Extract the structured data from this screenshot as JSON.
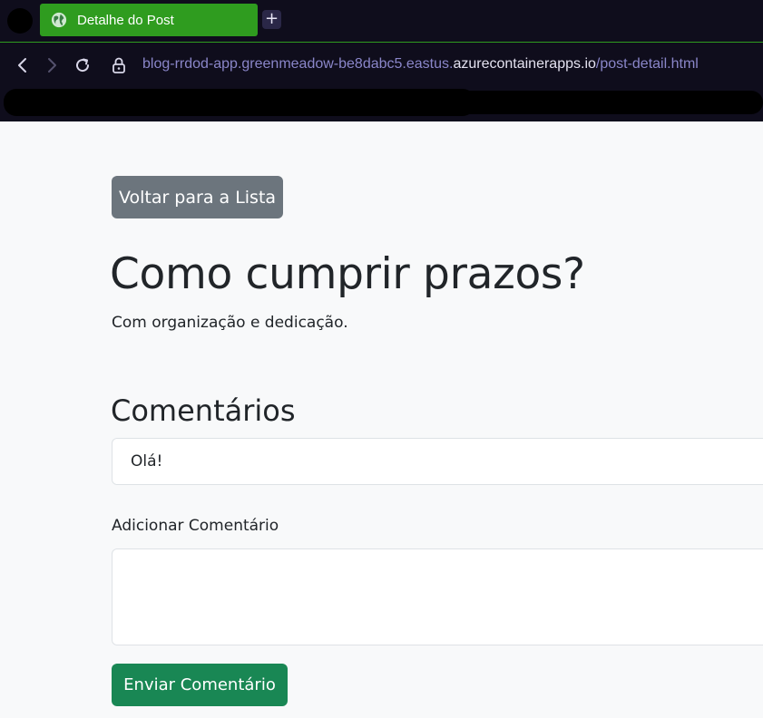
{
  "browser": {
    "tab_title": "Detalhe do Post",
    "new_tab_label": "+",
    "url_prefix": "blog-rrdod-app.greenmeadow-be8dabc5.eastus.",
    "url_domain": "azurecontainerapps.io",
    "url_path": "/post-detail.html"
  },
  "page": {
    "back_button_label": "Voltar para a Lista",
    "post_title": "Como cumprir prazos?",
    "post_content": "Com organização e dedicação.",
    "comments_heading": "Comentários",
    "comments": [
      "Olá!"
    ],
    "add_comment_label": "Adicionar Comentário",
    "comment_textarea_value": "",
    "submit_button_label": "Enviar Comentário"
  },
  "colors": {
    "tab_active": "#2f9c1f",
    "chrome_bg": "#0f0d1c",
    "button_secondary": "#6c757d",
    "button_success": "#198754",
    "page_bg": "#f8f9fa"
  }
}
